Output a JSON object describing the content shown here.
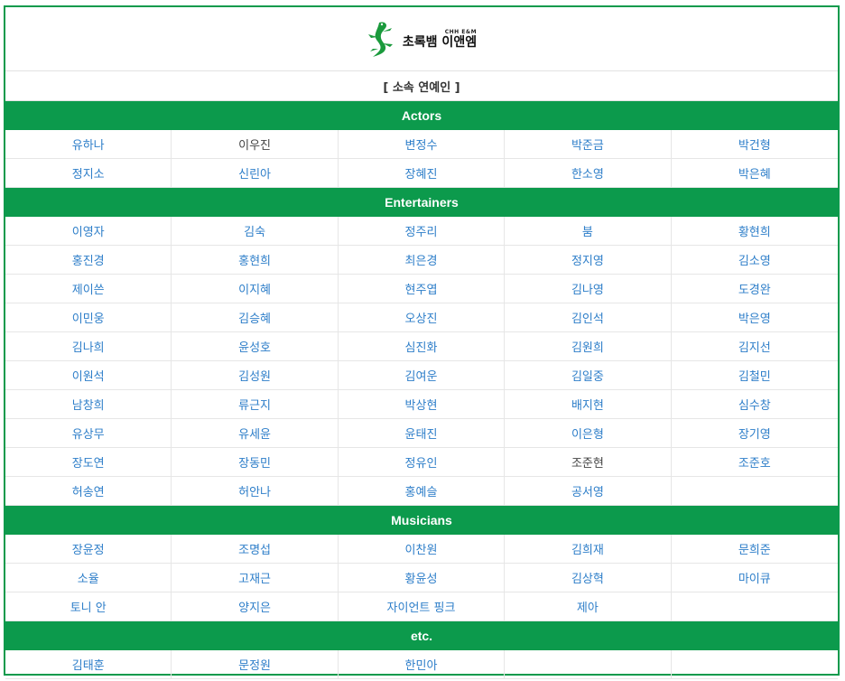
{
  "logo": {
    "sub": "CHH E&M",
    "main": "초록뱀 이앤엠"
  },
  "subtitle": "[ 소속 연예인 ]",
  "sections": [
    {
      "title": "Actors",
      "names": [
        "유하나",
        "이우진",
        "변정수",
        "박준금",
        "박건형",
        "정지소",
        "신린아",
        "장혜진",
        "한소영",
        "박은혜"
      ]
    },
    {
      "title": "Entertainers",
      "names": [
        "이영자",
        "김숙",
        "정주리",
        "붐",
        "황현희",
        "홍진경",
        "홍현희",
        "최은경",
        "정지영",
        "김소영",
        "제이쓴",
        "이지혜",
        "현주엽",
        "김나영",
        "도경완",
        "이민웅",
        "김승혜",
        "오상진",
        "김인석",
        "박은영",
        "김나희",
        "윤성호",
        "심진화",
        "김원희",
        "김지선",
        "이원석",
        "김성원",
        "김여운",
        "김일중",
        "김철민",
        "남창희",
        "류근지",
        "박상현",
        "배지현",
        "심수창",
        "유상무",
        "유세윤",
        "윤태진",
        "이은형",
        "장기영",
        "장도연",
        "장동민",
        "정유인",
        "조준현",
        "조준호",
        "허송연",
        "허안나",
        "홍예슬",
        "공서영",
        ""
      ]
    },
    {
      "title": "Musicians",
      "names": [
        "장윤정",
        "조명섭",
        "이찬원",
        "김희재",
        "문희준",
        "소율",
        "고재근",
        "황윤성",
        "김상혁",
        "마이큐",
        "토니 안",
        "양지은",
        "자이언트 핑크",
        "제아",
        ""
      ]
    },
    {
      "title": "etc.",
      "names": [
        "김태훈",
        "문정원",
        "한민아",
        "",
        ""
      ]
    }
  ],
  "colors": {
    "accent": "#0c9a4c",
    "link": "#2d7ec9",
    "plain": "#444444"
  }
}
